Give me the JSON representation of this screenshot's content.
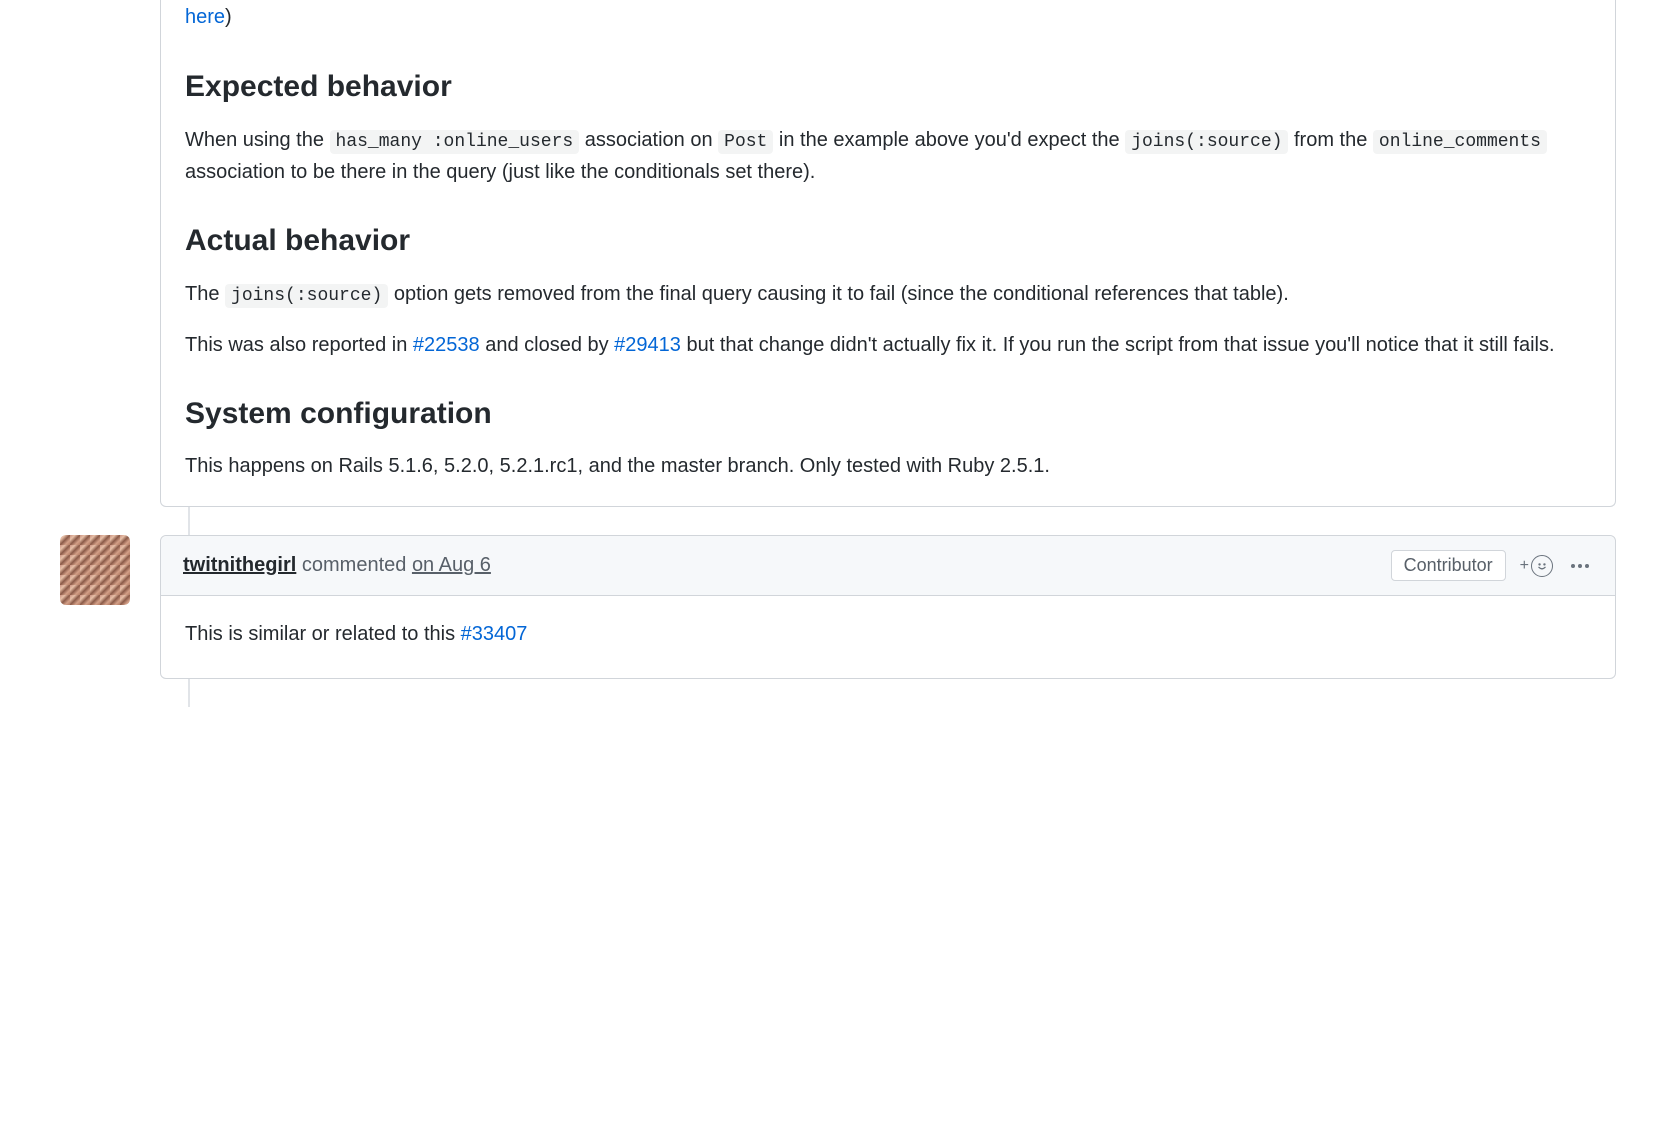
{
  "issue_body": {
    "truncated_link": "here",
    "truncated_tail": ")",
    "sections": {
      "expected": {
        "heading": "Expected behavior",
        "p1_parts": {
          "t1": "When using the ",
          "c1": "has_many :online_users",
          "t2": " association on ",
          "c2": "Post",
          "t3": " in the example above you'd expect the ",
          "c3": "joins(:source)",
          "t4": " from the ",
          "c4": "online_comments",
          "t5": " association to be there in the query (just like the conditionals set there)."
        }
      },
      "actual": {
        "heading": "Actual behavior",
        "p1_parts": {
          "t1": "The ",
          "c1": "joins(:source)",
          "t2": " option gets removed from the final query causing it to fail (since the conditional references that table)."
        },
        "p2_parts": {
          "t1": "This was also reported in ",
          "l1": "#22538",
          "t2": " and closed by ",
          "l2": "#29413",
          "t3": " but that change didn't actually fix it. If you run the script from that issue you'll notice that it still fails."
        }
      },
      "system": {
        "heading": "System configuration",
        "p1": "This happens on Rails 5.1.6, 5.2.0, 5.2.1.rc1, and the master branch. Only tested with Ruby 2.5.1."
      }
    }
  },
  "reply": {
    "author": "twitnithegirl",
    "verb": " commented ",
    "timestamp": "on Aug 6",
    "label": "Contributor",
    "body": {
      "t1": "This is similar or related to this ",
      "l1": "#33407"
    }
  }
}
